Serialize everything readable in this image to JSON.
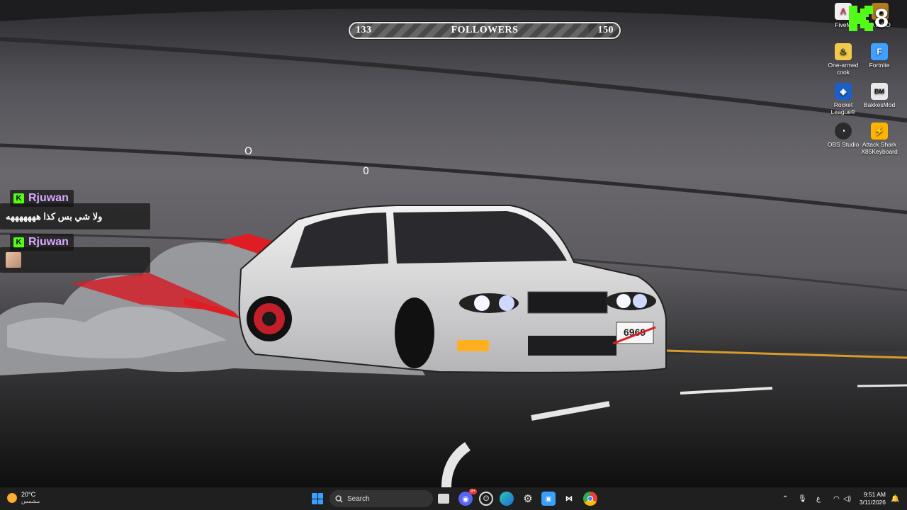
{
  "followers": {
    "current": "133",
    "label": "FOLLOWERS",
    "goal": "150",
    "progress": 0.887
  },
  "kick_logo": {
    "text": "8"
  },
  "desktop_icons": [
    {
      "label": "FiveM",
      "icon": "fivem-icon"
    },
    {
      "label": "D.E.P.D",
      "icon": "depd-icon"
    },
    {
      "label": "One-armed cook",
      "icon": "one-armed-cook-icon"
    },
    {
      "label": "Fortnite",
      "icon": "fortnite-icon"
    },
    {
      "label": "Rocket League®",
      "icon": "rocket-league-icon"
    },
    {
      "label": "BakkesMod",
      "icon": "bakkesmod-icon"
    },
    {
      "label": "OBS Studio",
      "icon": "obs-icon"
    },
    {
      "label": "Attack Shark X85Keyboard",
      "icon": "keyboard-app-icon"
    }
  ],
  "chat": [
    {
      "user": "Rjuwan",
      "badge": "K",
      "message": "ولا شي بس كذا هههههههه"
    },
    {
      "user": "Rjuwan",
      "badge": "K",
      "message": ""
    }
  ],
  "wallpaper": {
    "plate_number": "6969"
  },
  "taskbar": {
    "weather_temp": "20°C",
    "weather_condition": "مشمس",
    "search_placeholder": "Search",
    "discord_badge": "9+",
    "language": "ع",
    "time": "9:51 AM",
    "date": "3/11/2026"
  },
  "colors": {
    "kick_green": "#53fc18",
    "username_purple": "#d9a7ff",
    "taskbar_bg": "#1f1f1f"
  }
}
